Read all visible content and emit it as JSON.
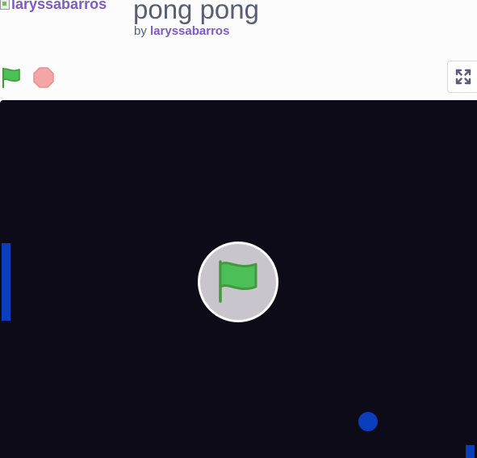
{
  "project": {
    "title": "pong pong",
    "by_prefix": "by",
    "author": "laryssabarros",
    "avatar_alt": "laryssabarros"
  },
  "controls": {
    "green_flag_icon": "green-flag-icon",
    "stop_icon": "stop-sign-icon",
    "fullscreen_icon": "fullscreen-icon"
  },
  "colors": {
    "accent": "#7d5ac9",
    "text": "#575e75",
    "stage_background": "#0e0b19",
    "paddle": "#0a3ebc",
    "ball": "#0a3ebc",
    "flag_green": "#4cbf56",
    "stop_red": "#f4a5a5"
  }
}
